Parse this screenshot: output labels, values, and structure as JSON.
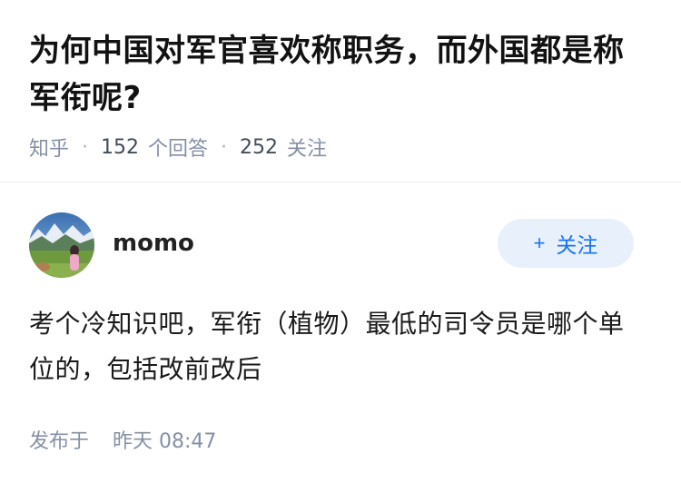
{
  "question": {
    "title": "为何中国对军官喜欢称职务，而外国都是称军衔呢?",
    "source": "知乎",
    "answer_count": "152",
    "answer_label": "个回答",
    "follower_count": "252",
    "follower_label": "关注",
    "separator": "·"
  },
  "answer": {
    "author": {
      "name": "momo",
      "avatar_icon": "avatar-photo-icon"
    },
    "follow_button": {
      "plus": "+",
      "label": "关注"
    },
    "content": "考个冷知识吧，军衔（植物）最低的司令员是哪个单位的，包括改前改后",
    "published_prefix": "发布于",
    "published_time": "昨天 08:47"
  },
  "colors": {
    "title": "#121212",
    "meta": "#8590a6",
    "accent": "#1772f6",
    "follow_bg": "#e8f1fb",
    "divider": "#ebedf0"
  }
}
